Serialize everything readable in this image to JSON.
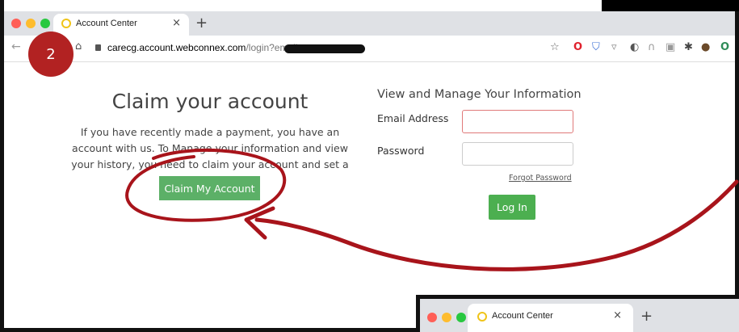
{
  "step_badge": "2",
  "browser": {
    "tab_title": "Account Center",
    "tab_close": "×",
    "new_tab": "+",
    "url_host": "carecg.account.webconnex.com",
    "url_path": "/login?email="
  },
  "claim": {
    "title": "Claim your account",
    "text": "If you have recently made a payment, you have an account with us. To Manage your information and view your history, you need to claim your account and set a password.",
    "button": "Claim My Account"
  },
  "login": {
    "title": "View and Manage Your Information",
    "email_label": "Email Address",
    "password_label": "Password",
    "email_value": "",
    "password_value": "",
    "forgot": "Forgot Password",
    "button": "Log In"
  },
  "mini_browser": {
    "tab_title": "Account Center",
    "tab_close": "×",
    "new_tab": "+"
  },
  "colors": {
    "badge": "#b22222",
    "annotation": "#a8141b",
    "claim_button": "#5cb067",
    "login_button": "#4caf50"
  },
  "icons": [
    "back-arrow-icon",
    "home-icon",
    "lock-icon",
    "star-icon",
    "opera-icon",
    "shield-icon",
    "extension-icon",
    "puzzle-icon",
    "avatar-icon"
  ]
}
